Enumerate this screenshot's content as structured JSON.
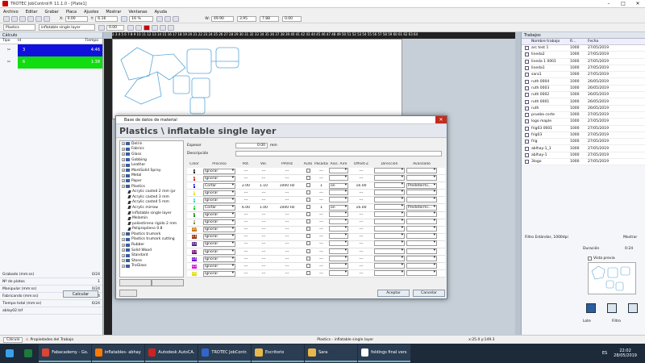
{
  "window": {
    "title": "TROTEC JobControl® 11.1.0 - [Plate1]"
  },
  "menu": [
    "Archivo",
    "Editar",
    "Grabar",
    "Placa",
    "Ajustes",
    "Mostrar",
    "Ventanas",
    "Ayuda"
  ],
  "toolbar1": {
    "x_label": "X:",
    "x_value": "0.00",
    "y_label": "Y:",
    "y_value": "6.16",
    "zoom_value": "16 %",
    "w_label": "W:",
    "w_value": "49.90",
    "h_value": "3.95",
    "h2_value": "7.88",
    "angle_value": "0.00"
  },
  "toolbar2": {
    "material_label": "Plastics",
    "material_select": "inflatable single layer",
    "value1": "0.00"
  },
  "left_panel": {
    "title": "Cálculo",
    "headers": [
      "Tipo",
      "Id",
      "Tiempo"
    ],
    "rows": [
      {
        "id": "3",
        "time": "4:46",
        "color": "#1111dd"
      },
      {
        "id": "6",
        "time": "1:38",
        "color": "#11dd11"
      }
    ],
    "stats": [
      {
        "label": "Grabado (mm:ss)",
        "value": "0/24"
      },
      {
        "label": "Nº de platos",
        "value": "1"
      },
      {
        "label": "Manipular (mm:ss)",
        "value": "0/24"
      },
      {
        "label": "Fabricando (mm:ss)",
        "value": "0/24"
      },
      {
        "label": "Tiempo total (mm:ss)",
        "value": "6/24"
      },
      {
        "label": "ablay02.tsf",
        "value": ""
      }
    ],
    "calc_button": "Calcular",
    "tabs": [
      "Cálculo",
      "Propiedades del Trabajo"
    ]
  },
  "ruler_top": "2 3 4 5 6 7 8 9 10 11 12 13 14 15 16 17 18 19 20 21 22 23 24 25 26 27 28 29 30 31 32 33 34 35 36 37 38 39 40 41 42 43 44 45 46 47 48 49 50 51 52 53 54 55 56 57 58 59 60 61 62 63 64",
  "right_panel": {
    "title": "Trabajos",
    "headers": [
      "Nombre trabajo",
      "R...",
      "Fecha"
    ],
    "jobs": [
      {
        "name": "arc test 1",
        "r": "1000",
        "date": "27/05/2019"
      },
      {
        "name": "lineda2",
        "r": "1000",
        "date": "27/05/2019"
      },
      {
        "name": "lineda 1 0001",
        "r": "1000",
        "date": "27/05/2019"
      },
      {
        "name": "lineda1",
        "r": "1000",
        "date": "27/05/2019"
      },
      {
        "name": "sara1",
        "r": "1000",
        "date": "27/05/2019"
      },
      {
        "name": "ruth 0004",
        "r": "1000",
        "date": "26/05/2019"
      },
      {
        "name": "ruth 0003",
        "r": "1000",
        "date": "26/05/2019"
      },
      {
        "name": "ruth 0002",
        "r": "1000",
        "date": "26/05/2019"
      },
      {
        "name": "ruth 0001",
        "r": "1000",
        "date": "26/05/2019"
      },
      {
        "name": "ruth",
        "r": "1000",
        "date": "26/05/2019"
      },
      {
        "name": "prueba corte",
        "r": "1000",
        "date": "27/05/2019"
      },
      {
        "name": "logo maple",
        "r": "1000",
        "date": "27/05/2019"
      },
      {
        "name": "frig03 0001",
        "r": "1000",
        "date": "27/05/2019"
      },
      {
        "name": "frig03",
        "r": "1000",
        "date": "27/05/2019"
      },
      {
        "name": "frig",
        "r": "1000",
        "date": "27/05/2019"
      },
      {
        "name": "ablhay-1_1",
        "r": "1000",
        "date": "27/05/2019"
      },
      {
        "name": "ablhay-1",
        "r": "1000",
        "date": "27/05/2019"
      },
      {
        "name": "3logo",
        "r": "1000",
        "date": "27/05/2019"
      }
    ],
    "filter_text": "Filtro Estándar, 1000dpi",
    "mostrar": "Mostrar",
    "duration_label": "Duración",
    "duration_value": "0:24",
    "vista_previa": "Vista previa",
    "lote_label": "Lote",
    "filtro_label": "Filtro"
  },
  "dialog": {
    "title": "Base de datos de material",
    "heading": "Plastics \\ inflatable single layer",
    "espesor_label": "Espesor",
    "espesor_value": "0.00",
    "espesor_unit": "mm",
    "descripcion_label": "Descripción",
    "tree": [
      {
        "label": "Delrin",
        "level": 0
      },
      {
        "label": "Fabrics",
        "level": 0
      },
      {
        "label": "Glass",
        "level": 0
      },
      {
        "label": "Gobbing",
        "level": 0
      },
      {
        "label": "Leather",
        "level": 0
      },
      {
        "label": "MarkSolid Spray",
        "level": 0
      },
      {
        "label": "Metal",
        "level": 0
      },
      {
        "label": "Paper",
        "level": 0
      },
      {
        "label": "Plastics",
        "level": 0
      },
      {
        "label": "Acrylic casted 2 mm (pr",
        "level": 1
      },
      {
        "label": "Acrylic casted 3 mm",
        "level": 1
      },
      {
        "label": "Acrylic casted 5 mm",
        "level": 1
      },
      {
        "label": "Acrylic mirrow",
        "level": 1
      },
      {
        "label": "inflatable single layer",
        "level": 1
      },
      {
        "label": "Melamin",
        "level": 1
      },
      {
        "label": "poliestireno rigido 2 mm",
        "level": 1
      },
      {
        "label": "Polipropileno 0.8",
        "level": 1
      },
      {
        "label": "Plastics trumark",
        "level": 0
      },
      {
        "label": "Plastics trumark cutting",
        "level": 0
      },
      {
        "label": "Rubber",
        "level": 0
      },
      {
        "label": "Solid Wood",
        "level": 0
      },
      {
        "label": "Standard",
        "level": 0
      },
      {
        "label": "Stone",
        "level": 0
      },
      {
        "label": "TroGlass",
        "level": 0
      }
    ],
    "headers": [
      "Color",
      "Proceso",
      "Pot.",
      "Vel.",
      "PPI/Hz",
      "Auto",
      "Pasadas",
      "Asis. Aire",
      "Offset-Z",
      "Dirección",
      "Avanzado"
    ],
    "rows": [
      {
        "num": "1",
        "color": "#111111",
        "proc": "Ignorar",
        "pot": "---",
        "vel": "---",
        "ppi": "---",
        "hz": "",
        "pas": "---",
        "air": "",
        "off": "---",
        "dir": "",
        "adv": ""
      },
      {
        "num": "2",
        "color": "#dd1111",
        "proc": "Ignorar",
        "pot": "---",
        "vel": "---",
        "ppi": "---",
        "hz": "",
        "pas": "---",
        "air": "",
        "off": "---",
        "dir": "",
        "adv": ""
      },
      {
        "num": "3",
        "color": "#1111dd",
        "proc": "Cortar",
        "pot": "2.00",
        "vel": "1.10",
        "ppi": "1000",
        "hz": "Hz",
        "pas": "1",
        "air": "on",
        "off": "16.00",
        "dir": "",
        "adv": "Predetermi..."
      },
      {
        "num": "4",
        "color": "#dddd11",
        "proc": "Ignorar",
        "pot": "---",
        "vel": "---",
        "ppi": "---",
        "hz": "",
        "pas": "---",
        "air": "",
        "off": "---",
        "dir": "",
        "adv": ""
      },
      {
        "num": "5",
        "color": "#11dddd",
        "proc": "Ignorar",
        "pot": "---",
        "vel": "---",
        "ppi": "---",
        "hz": "",
        "pas": "---",
        "air": "",
        "off": "---",
        "dir": "",
        "adv": ""
      },
      {
        "num": "6",
        "color": "#11cc11",
        "proc": "Cortar",
        "pot": "6.00",
        "vel": "1.00",
        "ppi": "1000",
        "hz": "Hz",
        "pas": "1",
        "air": "on",
        "off": "16.00",
        "dir": "",
        "adv": "Predetermi..."
      },
      {
        "num": "7",
        "color": "#228822",
        "proc": "Ignorar",
        "pot": "---",
        "vel": "---",
        "ppi": "---",
        "hz": "",
        "pas": "---",
        "air": "",
        "off": "---",
        "dir": "",
        "adv": ""
      },
      {
        "num": "8",
        "color": "#888833",
        "proc": "Ignorar",
        "pot": "---",
        "vel": "---",
        "ppi": "---",
        "hz": "",
        "pas": "---",
        "air": "",
        "off": "---",
        "dir": "",
        "adv": ""
      },
      {
        "num": "10",
        "color": "#cc7711",
        "proc": "Ignorar",
        "pot": "---",
        "vel": "---",
        "ppi": "---",
        "hz": "",
        "pas": "---",
        "air": "",
        "off": "---",
        "dir": "",
        "adv": ""
      },
      {
        "num": "11",
        "color": "#993311",
        "proc": "Ignorar",
        "pot": "---",
        "vel": "---",
        "ppi": "---",
        "hz": "",
        "pas": "---",
        "air": "",
        "off": "---",
        "dir": "",
        "adv": ""
      },
      {
        "num": "12",
        "color": "#552288",
        "proc": "Ignorar",
        "pot": "---",
        "vel": "---",
        "ppi": "---",
        "hz": "",
        "pas": "---",
        "air": "",
        "off": "---",
        "dir": "",
        "adv": ""
      },
      {
        "num": "13",
        "color": "#771177",
        "proc": "Ignorar",
        "pot": "---",
        "vel": "---",
        "ppi": "---",
        "hz": "",
        "pas": "---",
        "air": "",
        "off": "---",
        "dir": "",
        "adv": ""
      },
      {
        "num": "14",
        "color": "#7711cc",
        "proc": "Ignorar",
        "pot": "---",
        "vel": "---",
        "ppi": "---",
        "hz": "",
        "pas": "---",
        "air": "",
        "off": "---",
        "dir": "",
        "adv": ""
      },
      {
        "num": "15",
        "color": "#dd11dd",
        "proc": "Ignorar",
        "pot": "---",
        "vel": "---",
        "ppi": "---",
        "hz": "",
        "pas": "---",
        "air": "",
        "off": "---",
        "dir": "",
        "adv": ""
      },
      {
        "num": "16",
        "color": "#dddd11",
        "proc": "Ignorar",
        "pot": "---",
        "vel": "---",
        "ppi": "---",
        "hz": "",
        "pas": "---",
        "air": "",
        "off": "---",
        "dir": "",
        "adv": ""
      }
    ],
    "ok_button": "Aceptar",
    "cancel_button": "Cancelar"
  },
  "statusbar": {
    "left": "Plastics - inflatable single layer",
    "right": "x:25.0  y:149.3"
  },
  "taskbar": {
    "items": [
      {
        "label": "Fabacademy - Go...",
        "color": "#dd4433"
      },
      {
        "label": "inflatables- abhay ...",
        "color": "#ff7a00"
      },
      {
        "label": "Autodesk AutoCA...",
        "color": "#cc2222"
      },
      {
        "label": "TROTEC JobContr...",
        "color": "#3366cc"
      },
      {
        "label": "Escritorio",
        "color": "#e8b84a"
      },
      {
        "label": "Sara",
        "color": "#e8b84a"
      },
      {
        "label": "foldings final vers...",
        "color": "#ffffff"
      }
    ],
    "lang": "ES",
    "time": "22:02",
    "date": "28/05/2019"
  }
}
